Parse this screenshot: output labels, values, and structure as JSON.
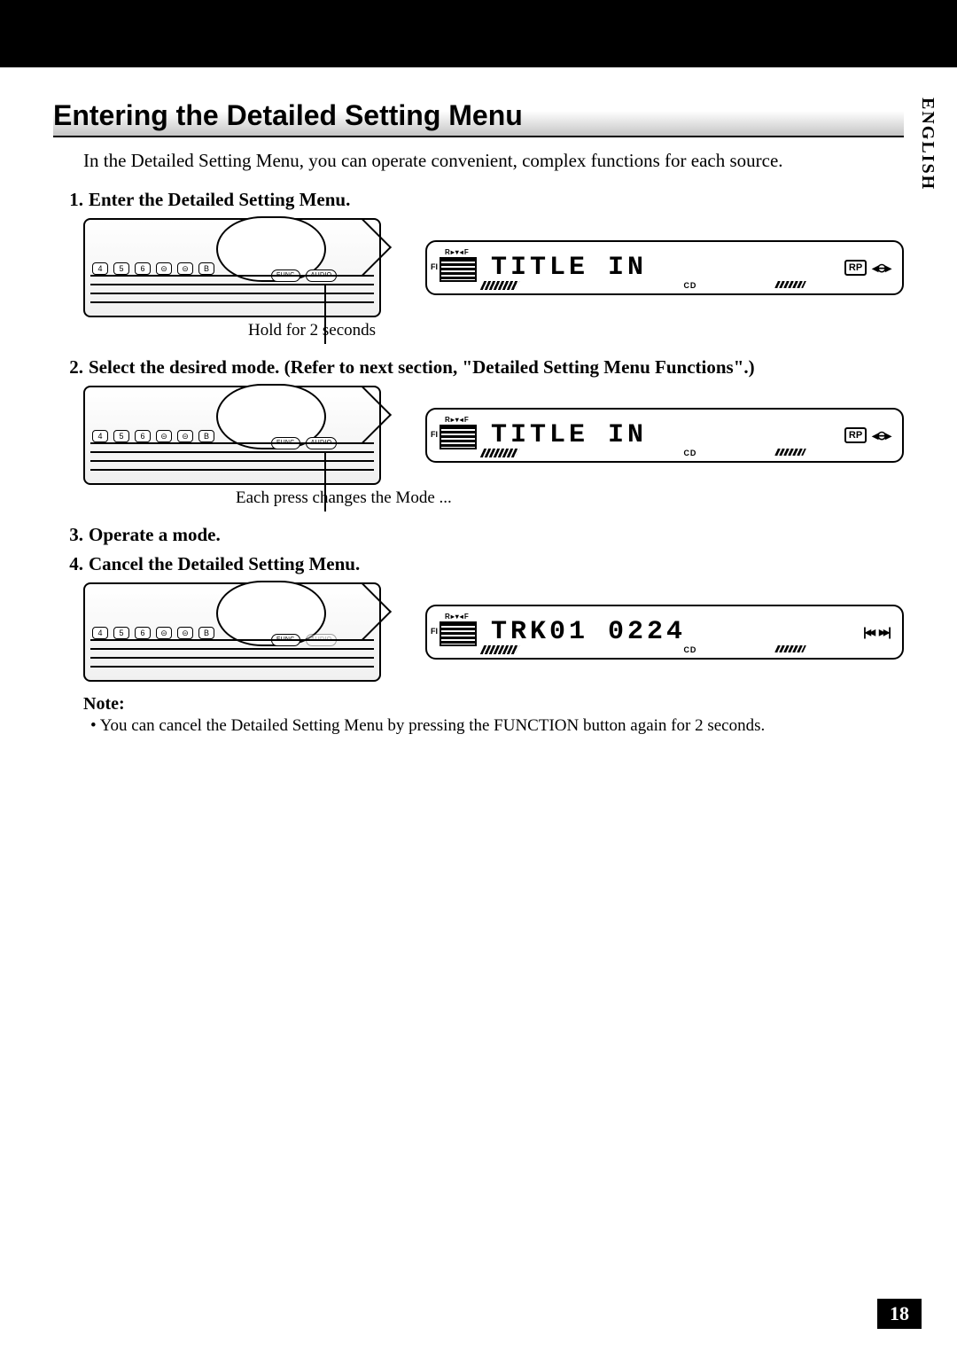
{
  "sideTab": "ENGLISH",
  "pageNumber": "18",
  "title": "Entering the Detailed Setting Menu",
  "intro": "In the Detailed Setting Menu, you can operate convenient, complex functions for each source.",
  "steps": {
    "s1": {
      "num": "1.",
      "text": "Enter the Detailed Setting Menu."
    },
    "s2": {
      "num": "2.",
      "text": "Select the desired mode. (Refer to next section, \"Detailed Setting Menu Functions\".)"
    },
    "s3": {
      "num": "3.",
      "text": "Operate a mode."
    },
    "s4": {
      "num": "4.",
      "text": "Cancel the Detailed Setting Menu."
    }
  },
  "captions": {
    "c1": "Hold for 2 seconds",
    "c2": "Each press changes the Mode ..."
  },
  "note": {
    "heading": "Note:",
    "items": [
      "You can cancel the Detailed Setting Menu by pressing the FUNCTION button again for 2 seconds."
    ]
  },
  "device": {
    "nums": [
      "4",
      "5",
      "6"
    ],
    "oval": [
      "⊝",
      "⊝"
    ],
    "b": "B",
    "func": "FUNC",
    "audio": "AUDIO"
  },
  "lcd": {
    "rf": "R▸▾◂F",
    "fi": "FI",
    "cd": "CD",
    "rp": "RP",
    "nav": "◂⊖▸",
    "prev": "|◂◂",
    "next": "▸▸|",
    "title_in": "TITLE IN",
    "track": "TRK01 0224"
  }
}
